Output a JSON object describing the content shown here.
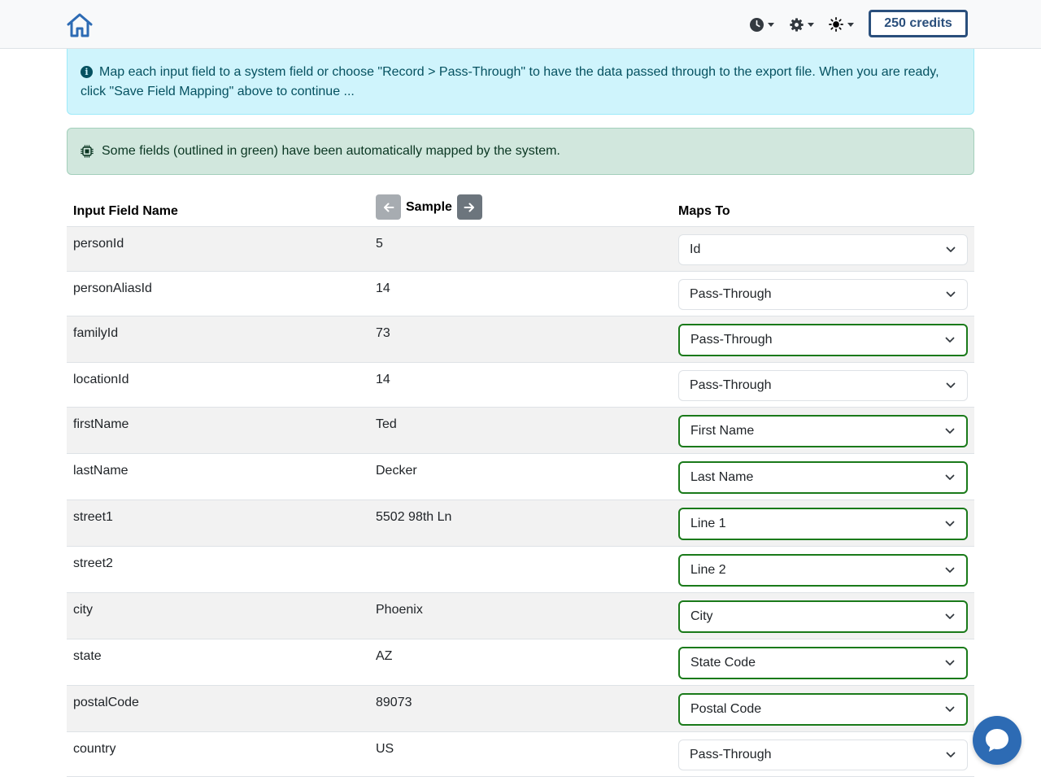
{
  "navbar": {
    "credits_label": "250 credits"
  },
  "alerts": {
    "info_text": "Map each input field to a system field or choose \"Record > Pass-Through\" to have the data passed through to the export file. When you are ready, click \"Save Field Mapping\" above to continue ...",
    "success_text": "Some fields (outlined in green) have been automatically mapped by the system."
  },
  "table": {
    "headers": {
      "input_field": "Input Field Name",
      "sample": "Sample",
      "maps_to": "Maps To"
    },
    "rows": [
      {
        "name": "personId",
        "sample": "5",
        "mapping": "Id",
        "auto": false
      },
      {
        "name": "personAliasId",
        "sample": "14",
        "mapping": "Pass-Through",
        "auto": false
      },
      {
        "name": "familyId",
        "sample": "73",
        "mapping": "Pass-Through",
        "auto": true
      },
      {
        "name": "locationId",
        "sample": "14",
        "mapping": "Pass-Through",
        "auto": false
      },
      {
        "name": "firstName",
        "sample": "Ted",
        "mapping": "First Name",
        "auto": true
      },
      {
        "name": "lastName",
        "sample": "Decker",
        "mapping": "Last Name",
        "auto": true
      },
      {
        "name": "street1",
        "sample": "5502 98th Ln",
        "mapping": "Line 1",
        "auto": true
      },
      {
        "name": "street2",
        "sample": "",
        "mapping": "Line 2",
        "auto": true
      },
      {
        "name": "city",
        "sample": "Phoenix",
        "mapping": "City",
        "auto": true
      },
      {
        "name": "state",
        "sample": "AZ",
        "mapping": "State Code",
        "auto": true
      },
      {
        "name": "postalCode",
        "sample": "89073",
        "mapping": "Postal Code",
        "auto": true
      },
      {
        "name": "country",
        "sample": "US",
        "mapping": "Pass-Through",
        "auto": false
      }
    ]
  },
  "colors": {
    "auto_mapped_border": "#1a7a1a",
    "brand": "#2a4f7c",
    "info_bg": "#cff4fc",
    "success_bg": "#d1e7dd"
  },
  "icons": {
    "home": "home-icon",
    "history": "clock-icon",
    "settings": "gear-icon",
    "theme": "sun-icon",
    "info": "info-circle-icon",
    "auto": "cpu-chip-icon",
    "prev": "arrow-left-icon",
    "next": "arrow-right-icon",
    "chat": "chat-bubble-icon"
  }
}
